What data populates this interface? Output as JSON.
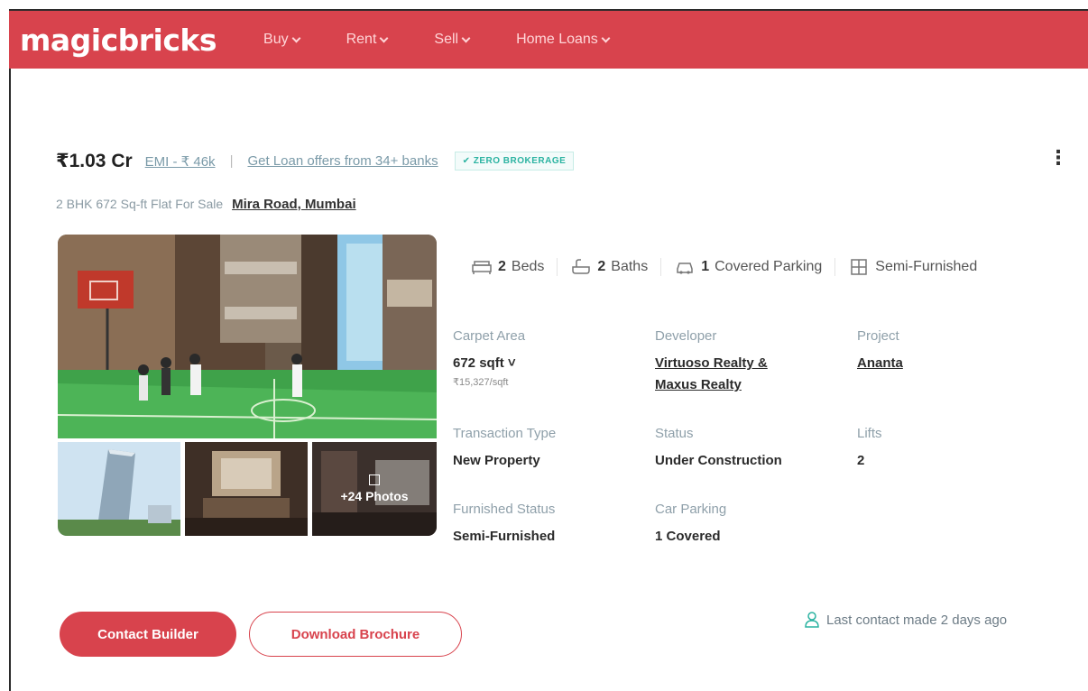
{
  "brand": {
    "name": "magicbricks",
    "color": "#d8434d"
  },
  "nav": {
    "items": [
      {
        "label": "Buy"
      },
      {
        "label": "Rent"
      },
      {
        "label": "Sell"
      },
      {
        "label": "Home Loans"
      }
    ]
  },
  "listing": {
    "price": "₹1.03 Cr",
    "emi": "EMI - ₹ 46k",
    "separator": "|",
    "loan_offer": "Get Loan offers from 34+ banks",
    "badge": "✔ ZERO BROKERAGE",
    "subtitle": "2 BHK 672 Sq-ft Flat For Sale",
    "location": "Mira Road, Mumbai",
    "more_menu": "⋮",
    "gallery": {
      "more_photos": "+24 Photos"
    },
    "amenities": {
      "beds": {
        "count": "2",
        "label": "Beds"
      },
      "baths": {
        "count": "2",
        "label": "Baths"
      },
      "parking": {
        "count": "1",
        "label": "Covered Parking"
      },
      "furnishing": {
        "label": "Semi-Furnished"
      }
    },
    "details": {
      "carpet_area": {
        "label": "Carpet Area",
        "value": "672 sqft ˅",
        "sub": "₹15,327/sqft"
      },
      "developer": {
        "label": "Developer",
        "value_line1": "Virtuoso Realty &",
        "value_line2": "Maxus Realty"
      },
      "project": {
        "label": "Project",
        "value": "Ananta"
      },
      "transaction_type": {
        "label": "Transaction Type",
        "value": "New Property"
      },
      "status": {
        "label": "Status",
        "value": "Under Construction"
      },
      "lifts": {
        "label": "Lifts",
        "value": "2"
      },
      "furnished_status": {
        "label": "Furnished Status",
        "value": "Semi-Furnished"
      },
      "car_parking": {
        "label": "Car Parking",
        "value": "1 Covered"
      }
    },
    "actions": {
      "contact_builder": "Contact Builder",
      "download_brochure": "Download Brochure"
    },
    "last_contact": "Last contact made 2 days ago"
  }
}
